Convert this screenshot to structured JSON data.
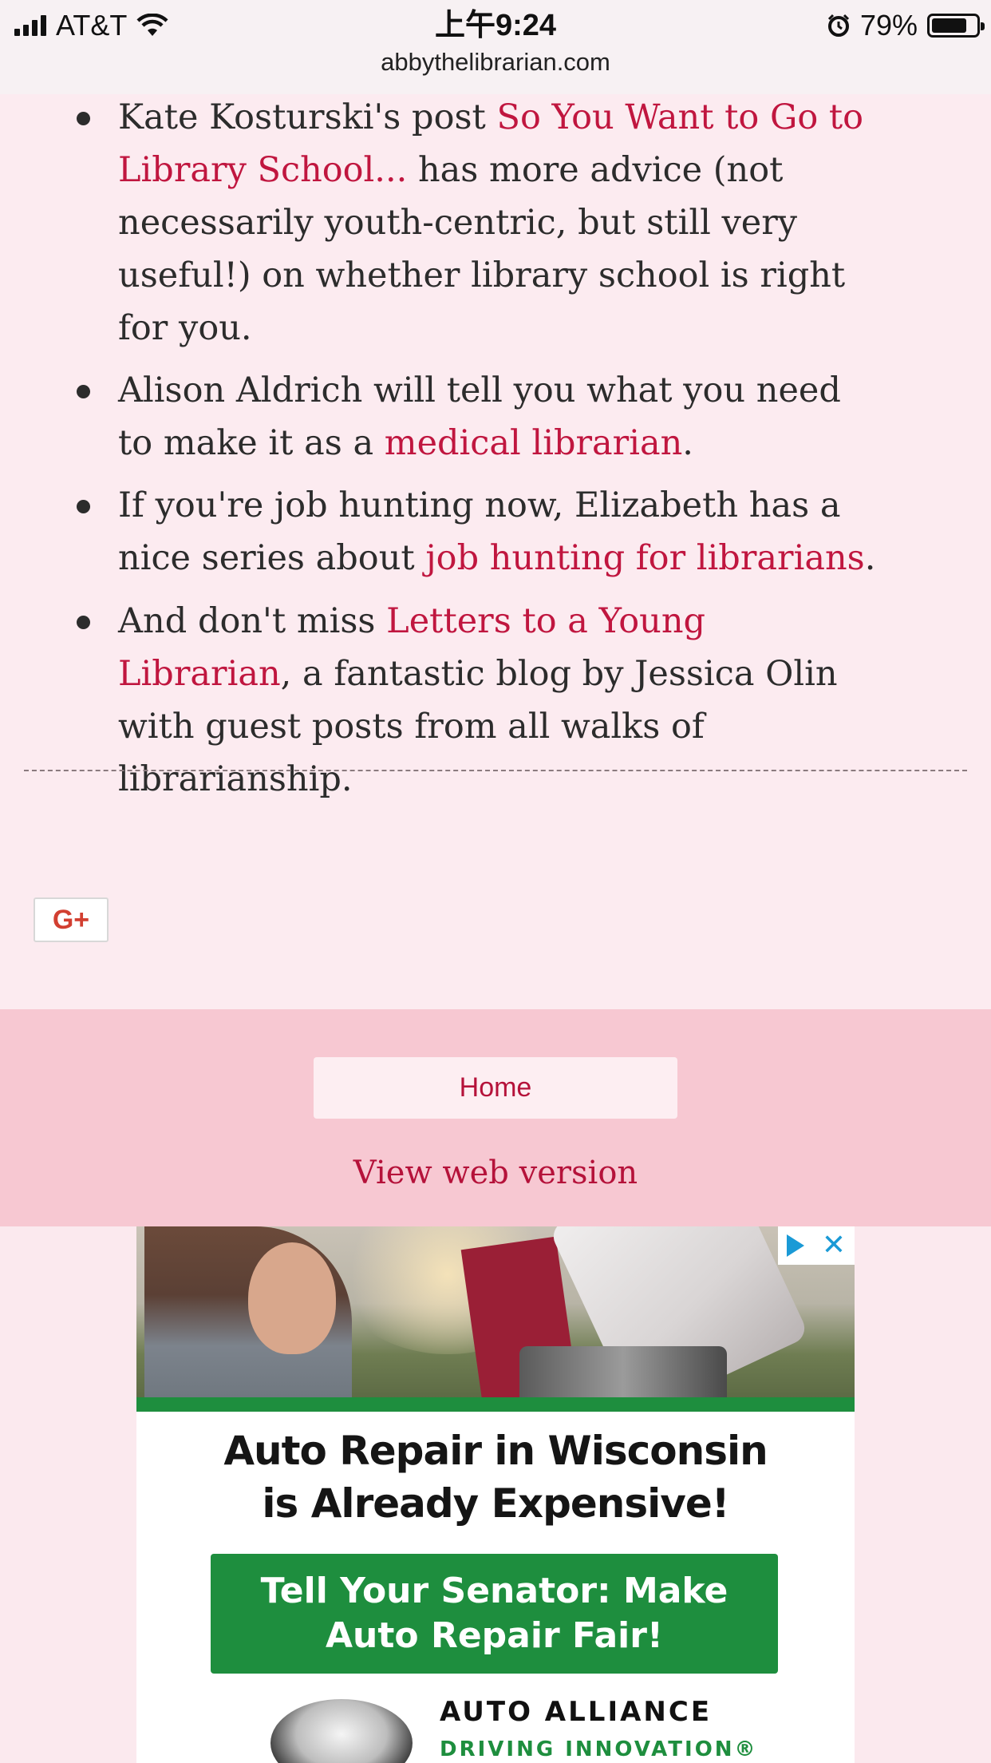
{
  "status_bar": {
    "carrier": "AT&T",
    "time": "上午9:24",
    "battery_percent": "79%",
    "battery_level": 0.79,
    "icons": [
      "signal-icon",
      "wifi-icon",
      "alarm-icon",
      "battery-icon"
    ]
  },
  "browser": {
    "url": "abbythelibrarian.com"
  },
  "article": {
    "items": [
      {
        "parts": [
          {
            "text": "Kate Kosturski's post ",
            "link": false
          },
          {
            "text": "So You Want to Go to Library School...",
            "link": true
          },
          {
            "text": " has more advice (not necessarily youth-centric, but still very useful!) on whether library school is right for you.",
            "link": false
          }
        ]
      },
      {
        "parts": [
          {
            "text": "Alison Aldrich will tell you what you need to make it as a ",
            "link": false
          },
          {
            "text": "medical librarian",
            "link": true
          },
          {
            "text": ".",
            "link": false
          }
        ]
      },
      {
        "parts": [
          {
            "text": "If you're job hunting now, Elizabeth has a nice series about ",
            "link": false
          },
          {
            "text": "job hunting for librarians",
            "link": true
          },
          {
            "text": ".",
            "link": false
          }
        ]
      },
      {
        "parts": [
          {
            "text": "And don't miss ",
            "link": false
          },
          {
            "text": "Letters to a Young Librarian",
            "link": true
          },
          {
            "text": ", a fantastic blog by Jessica Olin with guest posts from all walks of librarianship.",
            "link": false
          }
        ]
      }
    ],
    "share": {
      "gplus_label": "G+"
    }
  },
  "footer": {
    "home_label": "Home",
    "web_version_label": "View web version"
  },
  "ad": {
    "headline": "Auto Repair in Wisconsin is Already Expensive!",
    "cta": "Tell Your Senator: Make Auto Repair Fair!",
    "brand": "AUTO ALLIANCE",
    "tagline": "DRIVING INNOVATION®",
    "accent_color": "#1e8e3e"
  },
  "colors": {
    "link": "#c0163f",
    "background": "#fcebf0",
    "footer": "#f7c8d2"
  }
}
